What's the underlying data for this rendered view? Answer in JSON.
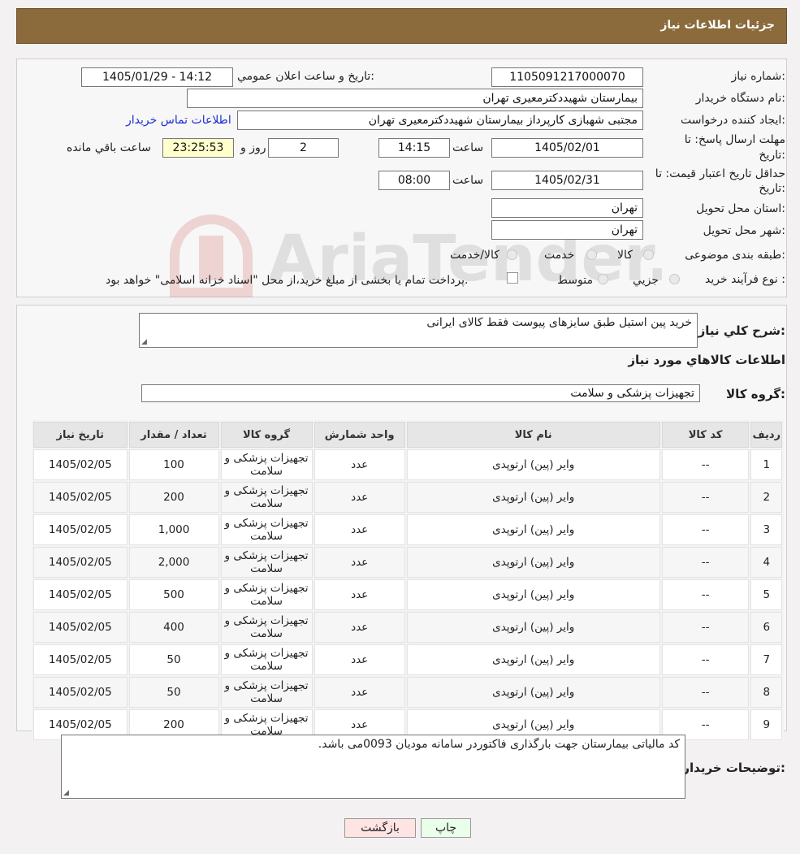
{
  "header": {
    "title": "جزئیات اطلاعات نیاز"
  },
  "form": {
    "need_number_label": "شماره نیاز:",
    "need_number": "1105091217000070",
    "announce_label": "تاریخ و ساعت اعلان عمومي:",
    "announce_value": "1405/01/29 - 14:12",
    "buyer_org_label": "نام دستگاه خریدار:",
    "buyer_org": "بیمارستان شهیددکترمعیری تهران",
    "creator_label": "ایجاد کننده درخواست:",
    "creator": "مجتبی  شهبازی کارپرداز بیمارستان شهیددکترمعیری تهران",
    "contact_link": "اطلاعات تماس خریدار",
    "deadline_label_1": "مهلت ارسال پاسخ: تا",
    "deadline_label_2": "تاریخ:",
    "deadline_date": "1405/02/01",
    "time_label": "ساعت",
    "deadline_time": "14:15",
    "days_value": "2",
    "days_label": "روز و",
    "remaining_time": "23:25:53",
    "remaining_label": "ساعت باقي مانده",
    "price_validity_label_1": "حداقل تاریخ اعتبار قیمت: تا",
    "price_validity_label_2": "تاریخ:",
    "price_validity_date": "1405/02/31",
    "price_validity_time": "08:00",
    "province_label": "استان محل تحویل:",
    "province": "تهران",
    "city_label": "شهر محل تحویل:",
    "city": "تهران",
    "category_label": "طبقه بندی موضوعی:",
    "category_options": [
      "کالا",
      "خدمت",
      "کالا/خدمت"
    ],
    "process_label": "نوع فرآیند خرید :",
    "process_options": [
      "جزیي",
      "متوسط"
    ],
    "process_note": "پرداخت تمام یا بخشی از مبلغ خرید،از محل \"اسناد خزانه اسلامی\" خواهد بود."
  },
  "details": {
    "summary_label": "شرح کلي نیاز:",
    "summary_text": "خرید پین استیل طبق سایزهای پیوست فقط کالای ایرانی",
    "goods_info_title": "اطلاعات کالاهاي مورد نیاز",
    "group_label": "گروه کالا:",
    "group_value": "تجهیزات پزشکی و سلامت"
  },
  "table": {
    "headers": [
      "ردیف",
      "کد کالا",
      "نام کالا",
      "واحد شمارش",
      "گروه کالا",
      "تعداد / مقدار",
      "تاریخ نیاز"
    ],
    "rows": [
      [
        "1",
        "--",
        "وایر (پین) ارتوپدی",
        "عدد",
        "تجهیزات پزشکی و سلامت",
        "100",
        "1405/02/05"
      ],
      [
        "2",
        "--",
        "وایر (پین) ارتوپدی",
        "عدد",
        "تجهیزات پزشکی و سلامت",
        "200",
        "1405/02/05"
      ],
      [
        "3",
        "--",
        "وایر (پین) ارتوپدی",
        "عدد",
        "تجهیزات پزشکی و سلامت",
        "1,000",
        "1405/02/05"
      ],
      [
        "4",
        "--",
        "وایر (پین) ارتوپدی",
        "عدد",
        "تجهیزات پزشکی و سلامت",
        "2,000",
        "1405/02/05"
      ],
      [
        "5",
        "--",
        "وایر (پین) ارتوپدی",
        "عدد",
        "تجهیزات پزشکی و سلامت",
        "500",
        "1405/02/05"
      ],
      [
        "6",
        "--",
        "وایر (پین) ارتوپدی",
        "عدد",
        "تجهیزات پزشکی و سلامت",
        "400",
        "1405/02/05"
      ],
      [
        "7",
        "--",
        "وایر (پین) ارتوپدی",
        "عدد",
        "تجهیزات پزشکی و سلامت",
        "50",
        "1405/02/05"
      ],
      [
        "8",
        "--",
        "وایر (پین) ارتوپدی",
        "عدد",
        "تجهیزات پزشکی و سلامت",
        "50",
        "1405/02/05"
      ],
      [
        "9",
        "--",
        "وایر (پین) ارتوپدی",
        "عدد",
        "تجهیزات پزشکی و سلامت",
        "200",
        "1405/02/05"
      ]
    ]
  },
  "notes": {
    "label": "توضیحات خریدار:",
    "text": "کد مالیاتی بیمارستان جهت بارگذاری فاکتوردر سامانه مودیان 0093می باشد."
  },
  "buttons": {
    "print": "چاپ",
    "back": "بازگشت"
  },
  "watermark": {
    "text": "AriaTender.neT"
  },
  "colors": {
    "header_bg": "#8b6a3c",
    "back_button_bg": "#ffe4e4",
    "print_button_bg": "#eaffea"
  }
}
